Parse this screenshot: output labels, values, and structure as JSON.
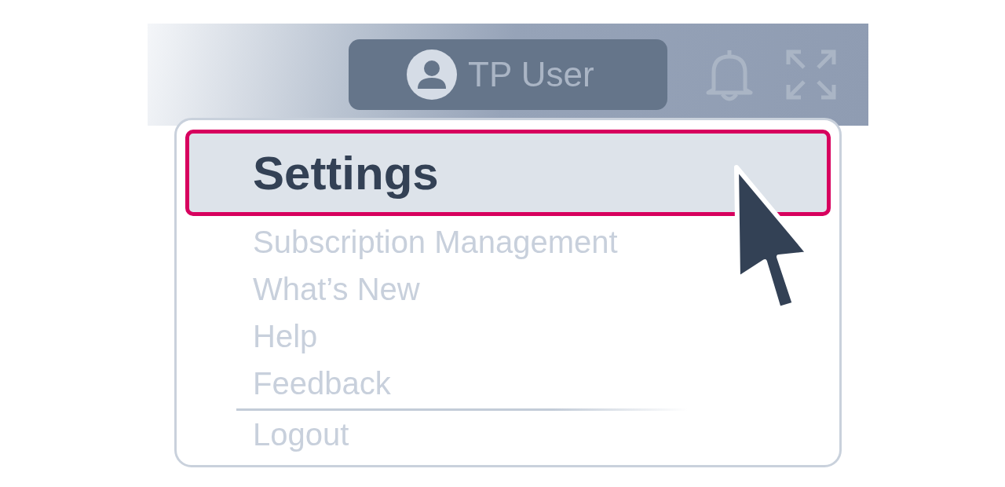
{
  "top_bar": {
    "user_button": {
      "label": "TP User"
    }
  },
  "menu": {
    "items": [
      {
        "label": "Settings",
        "selected": true
      },
      {
        "label": "Subscription Management",
        "selected": false
      },
      {
        "label": "What’s New",
        "selected": false
      },
      {
        "label": "Help",
        "selected": false
      },
      {
        "label": "Feedback",
        "selected": false
      }
    ],
    "footer_items": [
      {
        "label": "Logout",
        "selected": false
      }
    ]
  }
}
